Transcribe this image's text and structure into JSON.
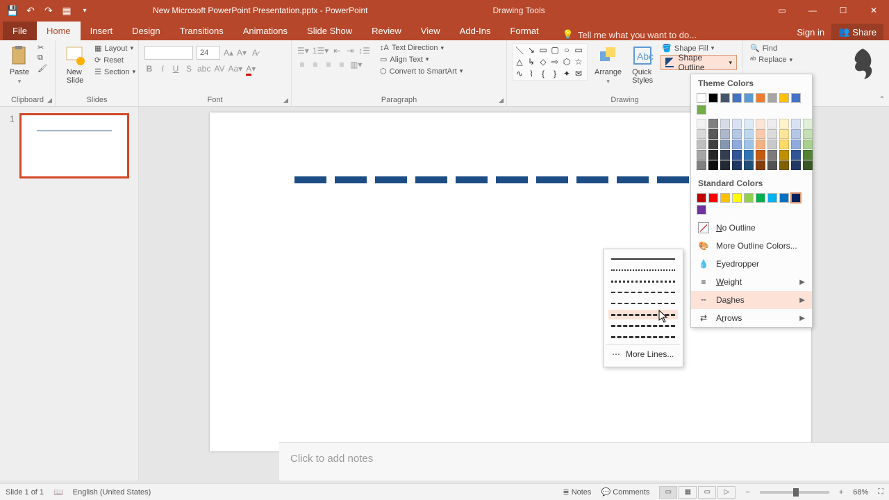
{
  "titlebar": {
    "doc_title": "New Microsoft PowerPoint Presentation.pptx - PowerPoint",
    "context_tab": "Drawing Tools"
  },
  "tabs": {
    "file": "File",
    "home": "Home",
    "insert": "Insert",
    "design": "Design",
    "transitions": "Transitions",
    "animations": "Animations",
    "slideshow": "Slide Show",
    "review": "Review",
    "view": "View",
    "addins": "Add-Ins",
    "format": "Format",
    "tellme_placeholder": "Tell me what you want to do...",
    "signin": "Sign in",
    "share": "Share"
  },
  "ribbon": {
    "clipboard": {
      "paste": "Paste",
      "label": "Clipboard"
    },
    "slides": {
      "new_slide": "New\nSlide",
      "layout": "Layout",
      "reset": "Reset",
      "section": "Section",
      "label": "Slides"
    },
    "font": {
      "size_value": "24",
      "label": "Font"
    },
    "paragraph": {
      "text_direction": "Text Direction",
      "align_text": "Align Text",
      "convert_smartart": "Convert to SmartArt",
      "label": "Paragraph"
    },
    "drawing": {
      "arrange": "Arrange",
      "quick_styles": "Quick\nStyles",
      "shape_fill": "Shape Fill",
      "shape_outline": "Shape Outline",
      "label": "Drawing"
    },
    "editing": {
      "find": "Find",
      "replace": "Replace"
    }
  },
  "dropdown": {
    "theme_colors": "Theme Colors",
    "standard_colors": "Standard Colors",
    "no_outline": "No Outline",
    "more_outline_colors": "More Outline Colors...",
    "eyedropper": "Eyedropper",
    "weight": "Weight",
    "dashes": "Dashes",
    "arrows": "Arrows",
    "theme_row": [
      "#ffffff",
      "#000000",
      "#44546a",
      "#4472c4",
      "#5b9bd5",
      "#ed7d31",
      "#a5a5a5",
      "#ffc000",
      "#4472c4",
      "#70ad47"
    ],
    "theme_shades": [
      [
        "#f2f2f2",
        "#d9d9d9",
        "#bfbfbf",
        "#a6a6a6",
        "#808080"
      ],
      [
        "#808080",
        "#595959",
        "#404040",
        "#262626",
        "#0d0d0d"
      ],
      [
        "#d6dce5",
        "#adb9ca",
        "#8497b0",
        "#333f50",
        "#222a35"
      ],
      [
        "#d9e2f3",
        "#b4c7e7",
        "#8faadc",
        "#2f5597",
        "#203864"
      ],
      [
        "#deebf7",
        "#bdd7ee",
        "#9dc3e6",
        "#2e75b6",
        "#1f4e79"
      ],
      [
        "#fbe5d6",
        "#f8cbad",
        "#f4b183",
        "#c55a11",
        "#843c0c"
      ],
      [
        "#ededed",
        "#dbdbdb",
        "#c9c9c9",
        "#7b7b7b",
        "#525252"
      ],
      [
        "#fff2cc",
        "#ffe699",
        "#ffd966",
        "#bf9000",
        "#806000"
      ],
      [
        "#d9e2f3",
        "#b4c7e7",
        "#8faadc",
        "#2f5597",
        "#203864"
      ],
      [
        "#e2f0d9",
        "#c5e0b4",
        "#a9d18e",
        "#548235",
        "#385723"
      ]
    ],
    "standard_row": [
      "#c00000",
      "#ff0000",
      "#ffc000",
      "#ffff00",
      "#92d050",
      "#00b050",
      "#00b0f0",
      "#0070c0",
      "#002060",
      "#7030a0"
    ],
    "selected_standard_index": 8
  },
  "flyout": {
    "more_lines": "More Lines..."
  },
  "notes": {
    "placeholder": "Click to add notes"
  },
  "statusbar": {
    "slide_of": "Slide 1 of 1",
    "language": "English (United States)",
    "notes": "Notes",
    "comments": "Comments",
    "zoom": "68%"
  },
  "thumb": {
    "num": "1"
  }
}
